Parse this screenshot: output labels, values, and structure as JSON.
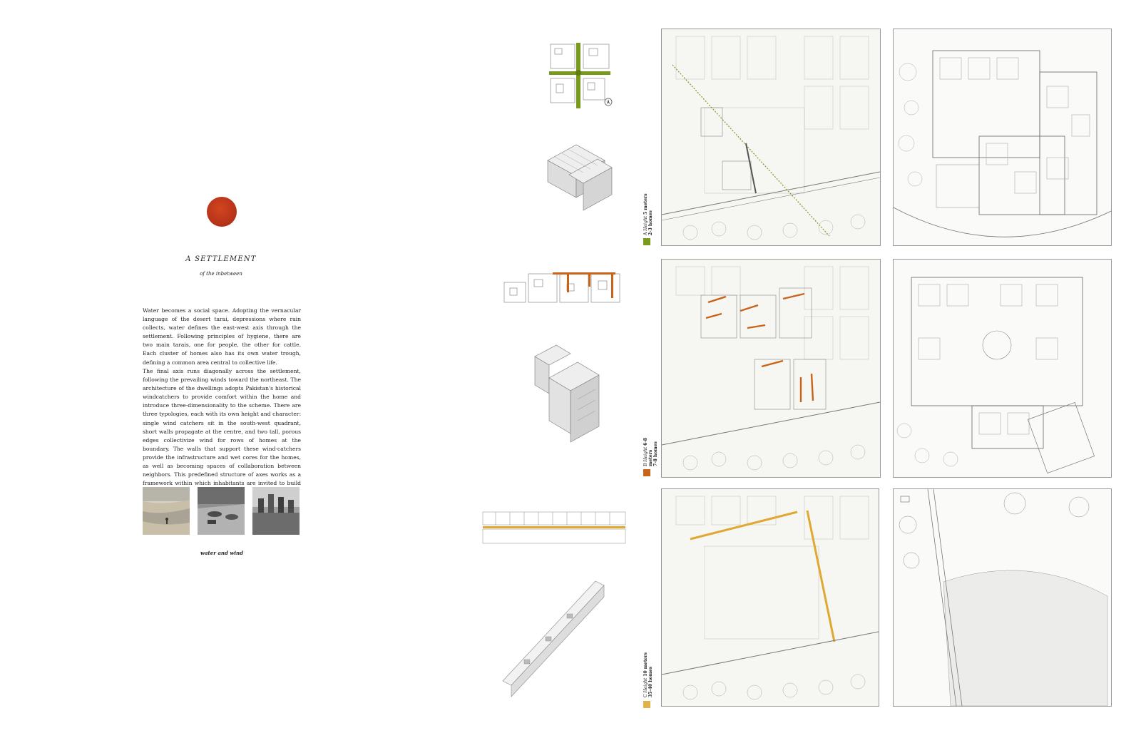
{
  "title": "A SETTLEMENT",
  "subtitle": "of the inbetween",
  "paragraphs": [
    "Water becomes a social space. Adopting the vernacular language of the desert tarai, depressions where rain collects, water defines the east-west axis through the settlement. Following principles of hygiene, there are two main tarais, one for people, the other for cattle. Each cluster of homes also has its own water trough, defining a common area central to collective life.",
    "The final axis runs diagonally across the settlement, following the prevailing winds toward the northeast. The architecture of the dwellings adopts Pakistan's historical windcatchers to provide comfort within the home and introduce three-dimensionality to the scheme. There are three typologies, each with its own height and character: single wind catchers sit in the south-west quadrant, short walls propagate at the centre, and two tall, porous edges collectivize wind for rows of homes at the boundary. The walls that support these wind-catchers provide the infrastructure and wet cores for the homes, as well as becoming spaces of collaboration between neighbors. This predefined structure of axes works as a framework within which inhabitants are invited to build their homes."
  ],
  "caption": "water and wind",
  "typologies": [
    {
      "letter": "A",
      "height_label": "Height",
      "height": "5 meters",
      "homes": "2-3 homes",
      "color": "#7a9a1e"
    },
    {
      "letter": "B",
      "height_label": "Height",
      "height": "6-8 meters",
      "homes": "7-8 homes",
      "color": "#c8641a"
    },
    {
      "letter": "C",
      "height_label": "Height",
      "height": "10 meters",
      "homes": "35-40 homes",
      "color": "#e0b24a"
    }
  ],
  "colors": {
    "seal": "#b8341a",
    "wind_a": "#7a9a1e",
    "wind_b": "#c8641a",
    "wind_c": "#e0a830"
  },
  "icons": [
    "seal-icon",
    "north-arrow-icon"
  ]
}
